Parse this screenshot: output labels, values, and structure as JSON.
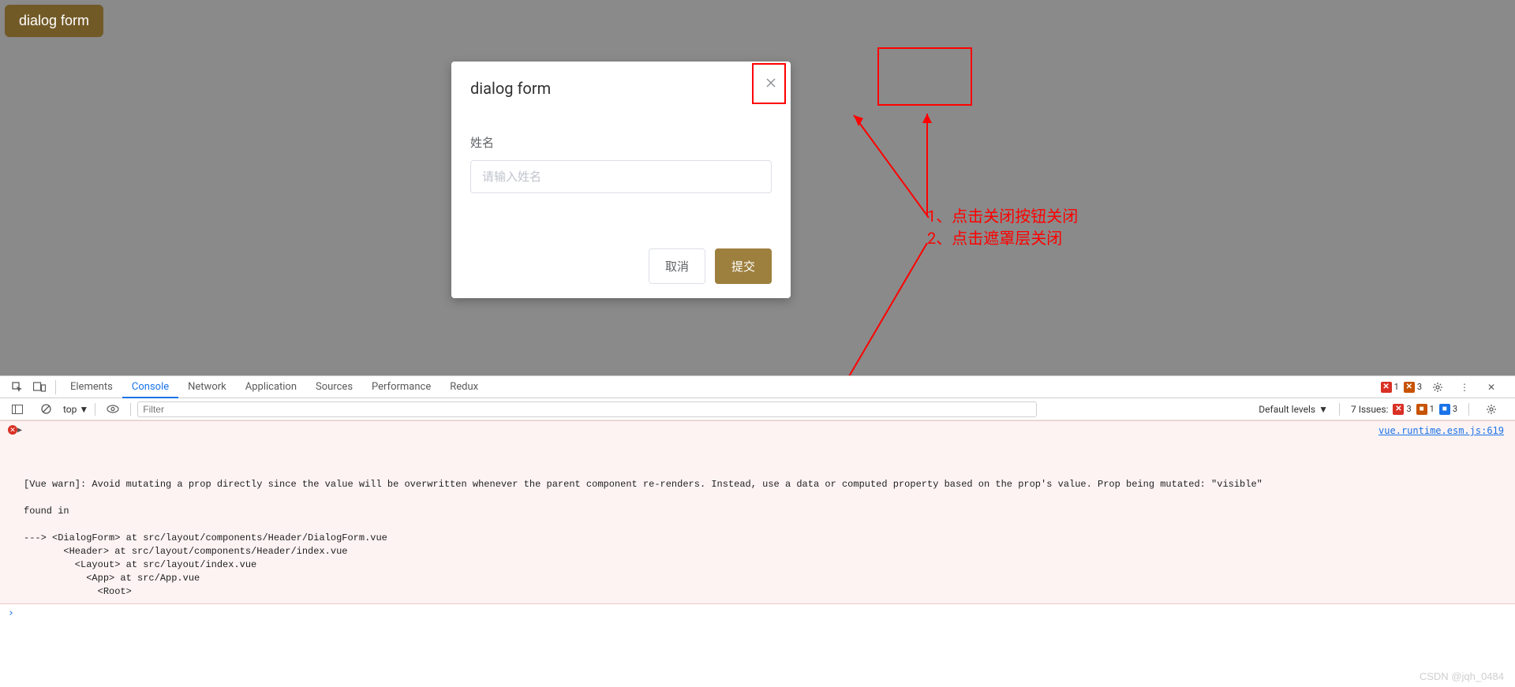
{
  "trigger": {
    "label": "dialog form"
  },
  "dialog": {
    "title": "dialog form",
    "form": {
      "name_label": "姓名",
      "name_placeholder": "请输入姓名"
    },
    "buttons": {
      "cancel": "取消",
      "submit": "提交"
    }
  },
  "annotations": {
    "line1": "1、点击关闭按钮关闭",
    "line2": "2、点击遮罩层关闭"
  },
  "devtools": {
    "tabs": [
      "Elements",
      "Console",
      "Network",
      "Application",
      "Sources",
      "Performance",
      "Redux"
    ],
    "active_tab": "Console",
    "error_count": "1",
    "warn_count": "3",
    "filterbar": {
      "context": "top",
      "filter_placeholder": "Filter",
      "levels": "Default levels",
      "issues_label": "7 Issues:",
      "issues_err": "3",
      "issues_warn": "1",
      "issues_info": "3"
    },
    "console_entry": {
      "warn_text": "[Vue warn]: Avoid mutating a prop directly since the value will be overwritten whenever the parent component re-renders. Instead, use a data or computed property based on the prop's value. Prop being mutated: \"visible\"",
      "found_in": "found in",
      "trace_1": "---> <DialogForm> at src/layout/components/Header/DialogForm.vue",
      "trace_2": "       <Header> at src/layout/components/Header/index.vue",
      "trace_3": "         <Layout> at src/layout/index.vue",
      "trace_4": "           <App> at src/App.vue",
      "trace_5": "             <Root>",
      "source_link": "vue.runtime.esm.js:619"
    }
  },
  "watermark": "CSDN @jqh_0484"
}
